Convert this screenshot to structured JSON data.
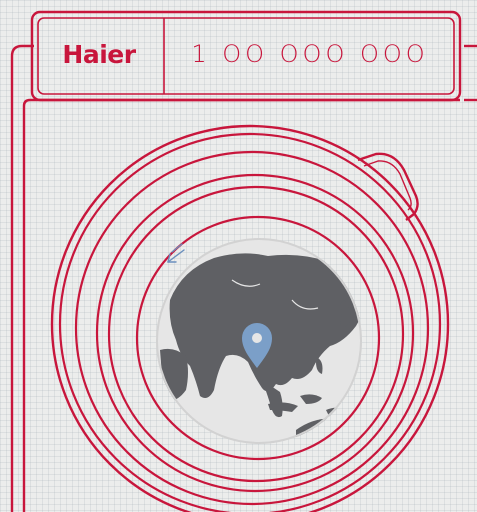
{
  "brand": {
    "logo_text": "Haier"
  },
  "display": {
    "counter_text": "1 OO OOO OOO"
  },
  "colors": {
    "outline": "#c8163c",
    "background": "#ecedec",
    "globe_ocean": "#e6e6e6",
    "globe_land": "#5f6064",
    "pin": "#7b9fc8"
  },
  "icons": {
    "map_pin": "map-pin-icon",
    "spin_arrow": "spin-arrow-icon"
  }
}
